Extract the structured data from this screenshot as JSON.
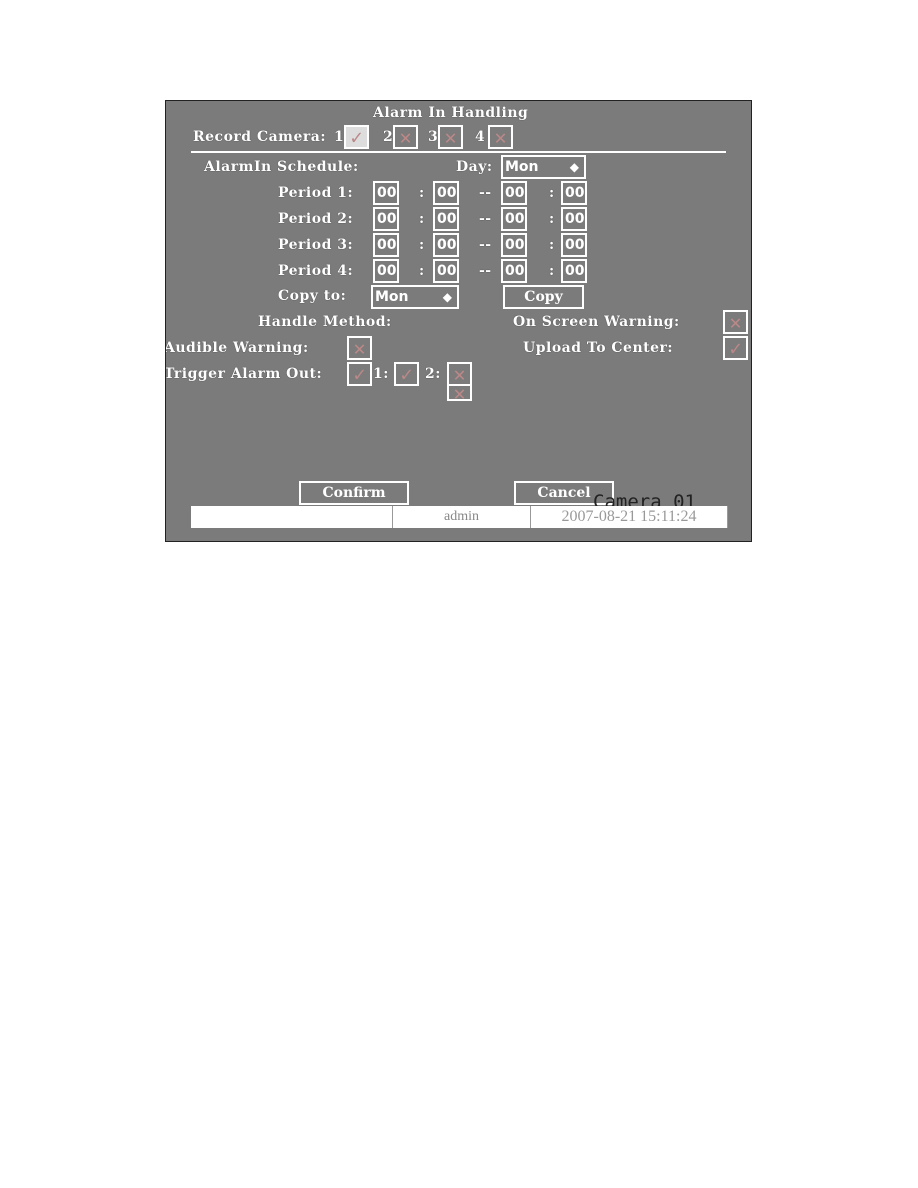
{
  "title": "Alarm In Handling",
  "record_camera": {
    "label": "Record Camera:",
    "cameras": [
      {
        "num": "1",
        "state": "checked"
      },
      {
        "num": "2",
        "state": "unchecked"
      },
      {
        "num": "3",
        "state": "unchecked"
      },
      {
        "num": "4",
        "state": "unchecked"
      }
    ]
  },
  "schedule": {
    "label": "AlarmIn Schedule:",
    "day_label": "Day:",
    "day_value": "Mon",
    "periods": [
      {
        "label": "Period 1:",
        "start_h": "00",
        "start_m": "00",
        "end_h": "00",
        "end_m": "00"
      },
      {
        "label": "Period 2:",
        "start_h": "00",
        "start_m": "00",
        "end_h": "00",
        "end_m": "00"
      },
      {
        "label": "Period 3:",
        "start_h": "00",
        "start_m": "00",
        "end_h": "00",
        "end_m": "00"
      },
      {
        "label": "Period 4:",
        "start_h": "00",
        "start_m": "00",
        "end_h": "00",
        "end_m": "00"
      }
    ],
    "colon": ":",
    "dash": "--",
    "copy_to_label": "Copy to:",
    "copy_to_value": "Mon",
    "copy_button": "Copy"
  },
  "handle": {
    "label": "Handle Method:",
    "on_screen": {
      "label": "On Screen Warning:",
      "state": "unchecked"
    },
    "audible": {
      "label": "Audible Warning:",
      "state": "unchecked"
    },
    "upload": {
      "label": "Upload To Center:",
      "state": "checked"
    },
    "trigger": {
      "label": "Trigger Alarm Out:",
      "outputs": [
        {
          "num": "1:",
          "state": "checked"
        },
        {
          "num": "2:",
          "state": "unchecked"
        }
      ],
      "first_state": "checked"
    }
  },
  "buttons": {
    "confirm": "Confirm",
    "cancel": "Cancel"
  },
  "overlay_camera": "Camera 01",
  "status": {
    "user": "admin",
    "datetime": "2007-08-21 15:11:24"
  }
}
